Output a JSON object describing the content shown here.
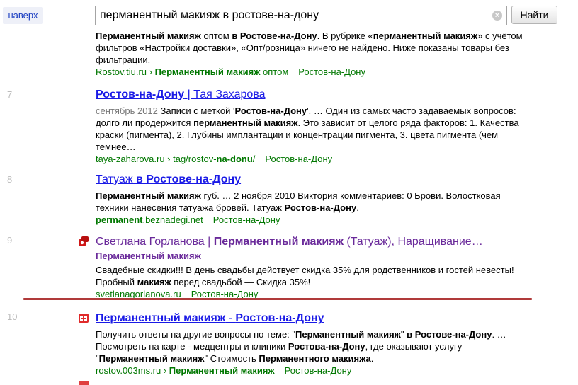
{
  "header": {
    "back_top": "наверх",
    "search_value": "перманентный макияж в ростове-на-дону",
    "find_button": "Найти",
    "clear_icon": "close-icon"
  },
  "colors": {
    "link": "#1a1ae6",
    "visited": "#6a2a9a",
    "url_green": "#007700",
    "divider": "#b03a3a"
  },
  "results": [
    {
      "snippet_segments": [
        {
          "t": "Перманентный макияж",
          "b": true
        },
        {
          "t": " оптом ",
          "b": false
        },
        {
          "t": "в Ростове-на-Дону",
          "b": true
        },
        {
          "t": ". В рубрике «",
          "b": false
        },
        {
          "t": "перманентный макияж",
          "b": true
        },
        {
          "t": "» с учётом фильтров «Настройки доставки», «Опт/розница» ничего не найдено. Ниже показаны товары без фильтрации.",
          "b": false
        }
      ],
      "url_segments": [
        {
          "t": "Rostov.tiu.ru › ",
          "b": false
        },
        {
          "t": "Перманентный макияж",
          "b": true
        },
        {
          "t": " оптом",
          "b": false
        }
      ],
      "region": "Ростов-на-Дону"
    },
    {
      "number": "7",
      "title_segments": [
        {
          "t": "Ростов-на-Дону",
          "b": true
        },
        {
          "t": " | Тая Захарова",
          "b": false
        }
      ],
      "date": "сентябрь 2012",
      "snippet_segments": [
        {
          "t": "  Записи с меткой '",
          "b": false
        },
        {
          "t": "Ростов-на-Дону",
          "b": true
        },
        {
          "t": "'. … Один из самых часто задаваемых вопросов: долго ли продержится ",
          "b": false
        },
        {
          "t": "перманентный макияж",
          "b": true
        },
        {
          "t": ". Это зависит от целого ряда факторов: 1. Качества краски (пигмента), 2. Глубины имплантации и концентрации пигмента, 3. цвета пигмента (чем темнее…",
          "b": false
        }
      ],
      "url_segments": [
        {
          "t": "taya-zaharova.ru › tag/rostov-",
          "b": false
        },
        {
          "t": "na-donu",
          "b": true
        },
        {
          "t": "/",
          "b": false
        }
      ],
      "region": "Ростов-на-Дону"
    },
    {
      "number": "8",
      "title_segments": [
        {
          "t": "Татуаж ",
          "b": false
        },
        {
          "t": "в Ростове-на-Дону",
          "b": true
        }
      ],
      "snippet_segments": [
        {
          "t": "Перманентный макияж",
          "b": true
        },
        {
          "t": " губ. … 2 ноября 2010 Виктория комментариев: 0 Брови. Волостковая техники нанесения татуажа бровей. Татуаж ",
          "b": false
        },
        {
          "t": "Ростов-на-Дону",
          "b": true
        },
        {
          "t": ".",
          "b": false
        }
      ],
      "url_segments": [
        {
          "t": "permanent",
          "b": true
        },
        {
          "t": ".beznadegi.net",
          "b": false
        }
      ],
      "region": "Ростов-на-Дону"
    },
    {
      "number": "9",
      "title_segments": [
        {
          "t": "Светлана Горланова | ",
          "b": false
        },
        {
          "t": "Перманентный макияж",
          "b": true
        },
        {
          "t": " (Татуаж), Наращивание…",
          "b": false
        }
      ],
      "sublink": "Перманентный макияж",
      "snippet_segments": [
        {
          "t": "Свадебные скидки!!! В день свадьбы действует скидка 35% для родственников и гостей невесты! Пробный ",
          "b": false
        },
        {
          "t": "макияж",
          "b": true
        },
        {
          "t": " перед свадьбой — Скидка 35%!",
          "b": false
        }
      ],
      "url_segments": [
        {
          "t": "svetlanagorlanova.ru",
          "b": false
        }
      ],
      "region": "Ростов-на-Дону"
    },
    {
      "number": "10",
      "title_segments": [
        {
          "t": "Перманентный макияж",
          "b": true
        },
        {
          "t": " - ",
          "b": false
        },
        {
          "t": "Ростов-на-Дону",
          "b": true
        }
      ],
      "snippet_segments": [
        {
          "t": "Получить ответы на другие вопросы по теме: \"",
          "b": false
        },
        {
          "t": "Перманентный макияж",
          "b": true
        },
        {
          "t": "\" ",
          "b": false
        },
        {
          "t": "в Ростове-на-Дону",
          "b": true
        },
        {
          "t": ". … Посмотреть на карте - медцентры и клиники ",
          "b": false
        },
        {
          "t": "Ростова-на-Дону",
          "b": true
        },
        {
          "t": ", где оказывают услугу \"",
          "b": false
        },
        {
          "t": "Перманентный макияж",
          "b": true
        },
        {
          "t": "\" Стоимость ",
          "b": false
        },
        {
          "t": "Перманентного макияжа",
          "b": true
        },
        {
          "t": ".",
          "b": false
        }
      ],
      "url_segments": [
        {
          "t": "rostov.003ms.ru › ",
          "b": false
        },
        {
          "t": "Перманентный макияж",
          "b": true
        }
      ],
      "region": "Ростов-на-Дону"
    }
  ]
}
